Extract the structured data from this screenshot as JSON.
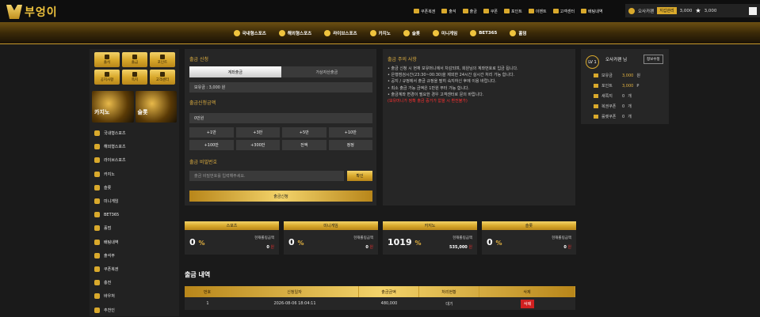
{
  "header": {
    "logo_text": "부엉이",
    "menu": [
      "쿠폰복권",
      "출석",
      "출금",
      "쿠폰",
      "포인트",
      "이벤트",
      "고객센터",
      "배팅내역"
    ],
    "user": {
      "name": "오사카팬",
      "badge": "지갑관리",
      "money": "3,000",
      "points": "3,000"
    }
  },
  "gamebar": [
    "국내형스포츠",
    "해외형스포츠",
    "라이브스포츠",
    "카지노",
    "슬롯",
    "미니게임",
    "BET365",
    "홀덤"
  ],
  "quick": [
    "출석",
    "출금",
    "포인트",
    "공지사항",
    "쪽지",
    "고객센터"
  ],
  "promo": [
    "카지노",
    "슬롯"
  ],
  "leftnav": [
    "국내형스포츠",
    "해외형스포츠",
    "라이브스포츠",
    "카지노",
    "슬롯",
    "미니게임",
    "BET365",
    "홀덤",
    "배팅내역",
    "출석부",
    "쿠폰복권",
    "충전",
    "바우처",
    "추천인"
  ],
  "withdraw": {
    "title": "출금 신청",
    "tab_account": "계좌출금",
    "tab_crypto": "가상자산출금",
    "balance": "보유금 : 3,000 원",
    "amount_label": "출금신청금액",
    "amount_value": "0만원",
    "amounts": [
      "+1만",
      "+3만",
      "+5만",
      "+10만",
      "+100만",
      "+300만",
      "전액",
      "정정"
    ],
    "pw_label": "출금 비밀번호",
    "pw_placeholder": "출금 비밀번호를 입력해주세요.",
    "confirm": "확인",
    "submit": "출금신청"
  },
  "notice": {
    "title": "출금 주의 사항",
    "items": [
      "출금 신청 시 현재 보유머니에서 차감되며, 회원님의 계좌번호로 입금 됩니다.",
      "은행점검시간(23:30~00:30)을 제외한 24시간 실시간 처리 가능 합니다.",
      "공지 / 규정에서 출금 규정을 필히 숙지하신 후에 이용 바랍니다.",
      "최소 출금 가능 금액은 1만원 부터 가능 합니다.",
      "출금계좌 변경이 필요한 경우 고객센터로 문의 바랍니다."
    ],
    "warning": "(보유머니가 정확 출금 증거가 없을 시 환전불가)"
  },
  "info": {
    "level": "LV 1",
    "name": "오사카팬 님",
    "edit": "정보수정",
    "rows": [
      {
        "label": "보유금",
        "value": "3,000",
        "unit": "원"
      },
      {
        "label": "포인트",
        "value": "3,000",
        "unit": "P"
      },
      {
        "label": "새쪽지",
        "value": "0",
        "unit": "개"
      },
      {
        "label": "복권쿠폰",
        "value": "0",
        "unit": "개"
      },
      {
        "label": "룰렛쿠폰",
        "value": "0",
        "unit": "개"
      }
    ]
  },
  "stats": [
    {
      "title": "스포츠",
      "big": "0",
      "pct": "%",
      "label": "현재롤링금액",
      "amount": "0",
      "unit": "원"
    },
    {
      "title": "미니게임",
      "big": "0",
      "pct": "%",
      "label": "현재롤링금액",
      "amount": "0",
      "unit": "원"
    },
    {
      "title": "카지노",
      "big": "1019",
      "pct": "%",
      "label": "현재롤링금액",
      "amount": "535,000",
      "unit": "원"
    },
    {
      "title": "슬롯",
      "big": "0",
      "pct": "%",
      "label": "현재롤링금액",
      "amount": "0",
      "unit": "원"
    }
  ],
  "history": {
    "title": "출금 내역",
    "columns": [
      "번호",
      "신청일자",
      "출금금액",
      "처리현황",
      "삭제"
    ],
    "rows": [
      {
        "no": "1",
        "date": "2026-08-06 18:04:11",
        "amount": "480,000",
        "status": "대기",
        "del": "삭제"
      }
    ]
  }
}
